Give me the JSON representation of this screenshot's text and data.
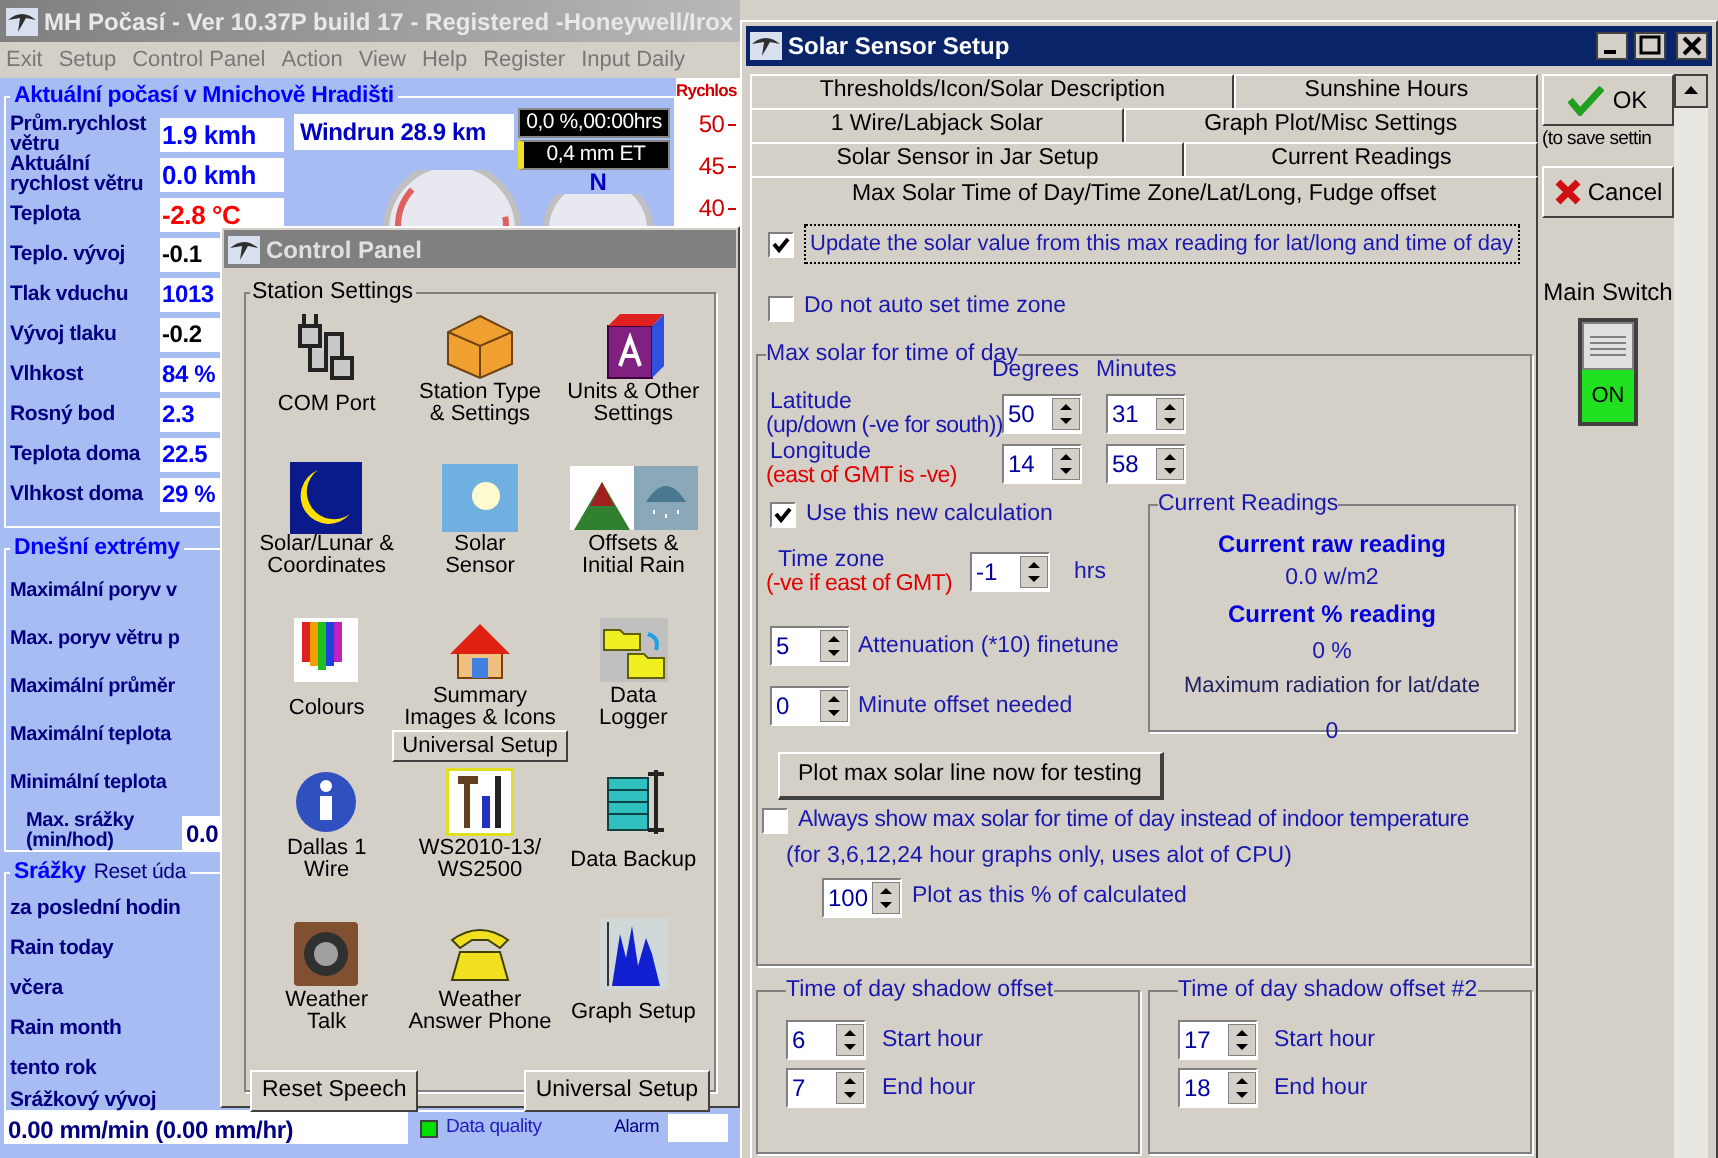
{
  "main_window": {
    "title": "MH Počasí - Ver 10.37P build 17 - Registered  -Honeywell/Irox",
    "menu": [
      "Exit",
      "Setup",
      "Control Panel",
      "Action",
      "View",
      "Help",
      "Register",
      "Input Daily"
    ],
    "current": {
      "title": "Aktuální počasí v Mnichově Hradišti",
      "rows": [
        {
          "label": "Prům.rychlost větru",
          "value": "1.9 kmh",
          "color": "#0000ff"
        },
        {
          "label": "Aktuální rychlost větru",
          "value": "0.0 kmh",
          "color": "#0000ff"
        },
        {
          "label": "Teplota",
          "value": "-2.8 °C",
          "color": "#ff0000"
        },
        {
          "label": "Teplo. vývoj",
          "value": "-0.1",
          "color": "#000000"
        },
        {
          "label": "Tlak vduchu",
          "value": "1013",
          "color": "#0000ff"
        },
        {
          "label": "Vývoj tlaku",
          "value": "-0.2",
          "color": "#000000"
        },
        {
          "label": "Vlhkost",
          "value": "84 %",
          "color": "#0000ff"
        },
        {
          "label": "Rosný bod",
          "value": "2.3",
          "color": "#0000ff"
        },
        {
          "label": "Teplota doma",
          "value": "22.5",
          "color": "#0000ff"
        },
        {
          "label": "Vlhkost doma",
          "value": "29 %",
          "color": "#0000ff"
        }
      ],
      "windrun": "Windrun 28.9 km",
      "displays": [
        "0,0 %,00:00hrs",
        "0,4 mm ET"
      ],
      "compass_label": "N",
      "speed_scale": {
        "title": "Rychlos",
        "ticks": [
          "50",
          "45",
          "40"
        ]
      }
    },
    "extremes": {
      "title": "Dnešní extrémy",
      "rows": [
        "Maximální poryv v",
        "Max. poryv větru p",
        "Maximální průměr",
        "Maximální teplota",
        "Minimální teplota"
      ],
      "rain_rate": {
        "label": "Max. srážky (min/hod)",
        "value": "0.0"
      }
    },
    "rain": {
      "title": "Srážky",
      "reset": "Reset úda",
      "rows": [
        "za poslední hodin",
        "Rain today",
        "včera",
        "Rain month",
        "tento rok"
      ],
      "trend_label": "Srážkový vývoj",
      "trend_value": "0.00 mm/min (0.00 mm/hr)"
    },
    "status": {
      "data_quality": "Data quality",
      "alarm": "Alarm"
    }
  },
  "control_panel": {
    "title": "Control Panel",
    "group": "Station Settings",
    "items": [
      {
        "label": "COM Port"
      },
      {
        "label": "Station Type\n& Settings"
      },
      {
        "label": "Units & Other\nSettings"
      },
      {
        "label": "Solar/Lunar &\nCoordinates"
      },
      {
        "label": "Solar\nSensor"
      },
      {
        "label": "Offsets &\nInitial Rain"
      },
      {
        "label": "Colours"
      },
      {
        "label": "Summary\nImages & Icons",
        "button": "Universal Setup"
      },
      {
        "label": "Data\nLogger"
      },
      {
        "label": "Dallas 1\nWire"
      },
      {
        "label": "WS2010-13/\nWS2500"
      },
      {
        "label": "Data Backup"
      },
      {
        "label": "Weather\nTalk"
      },
      {
        "label": "Weather\nAnswer Phone"
      },
      {
        "label": "Graph Setup"
      }
    ],
    "buttons": [
      "Reset Speech",
      "Universal Setup"
    ]
  },
  "solar_dialog": {
    "title": "Solar Sensor Setup",
    "tab_rows": [
      [
        {
          "label": "Thresholds/Icon/Solar Description",
          "selected": false
        },
        {
          "label": "Sunshine Hours",
          "selected": false
        }
      ],
      [
        {
          "label": "1 Wire/Labjack Solar",
          "selected": false
        },
        {
          "label": "Graph Plot/Misc Settings",
          "selected": false
        }
      ],
      [
        {
          "label": "Solar Sensor in Jar Setup",
          "selected": false
        },
        {
          "label": "Current Readings",
          "selected": false
        }
      ],
      [
        {
          "label": "Max Solar Time of Day/Time Zone/Lat/Long, Fudge offset",
          "selected": true
        }
      ]
    ],
    "update_checkbox": {
      "label": "Update the solar value from this max reading for lat/long and time of day",
      "checked": true
    },
    "auto_tz_checkbox": {
      "label": "Do not auto set time zone",
      "checked": false
    },
    "max_solar": {
      "title": "Max solar for time of day",
      "degrees_header": "Degrees",
      "minutes_header": "Minutes",
      "latitude": {
        "label": "Latitude",
        "note": "(up/down (-ve for south))",
        "degrees": "50",
        "minutes": "31"
      },
      "longitude": {
        "label": "Longitude",
        "note": "(east of GMT is -ve)",
        "degrees": "14",
        "minutes": "58"
      },
      "new_calc_checkbox": {
        "label": "Use this new calculation",
        "checked": true
      },
      "time_zone": {
        "label": "Time zone",
        "note": "(-ve if east of GMT)",
        "value": "-1",
        "unit": "hrs"
      },
      "attenuation": {
        "value": "5",
        "label": "Attenuation (*10) finetune"
      },
      "minute_offset": {
        "value": "0",
        "label": "Minute offset needed"
      },
      "readings": {
        "title": "Current Readings",
        "raw_label": "Current raw reading",
        "raw_value": "0.0 w/m2",
        "pct_label": "Current % reading",
        "pct_value": "0 %",
        "max_label": "Maximum radiation for lat/date",
        "max_value": "0"
      },
      "plot_button": "Plot max solar line now for testing",
      "always_checkbox": {
        "label": "Always show max solar for time of day instead of indoor temperature",
        "checked": false
      },
      "always_note": "(for 3,6,12,24 hour graphs only, uses alot of CPU)",
      "plot_pct": {
        "value": "100",
        "label": "Plot as this % of calculated"
      }
    },
    "shadow_groups": [
      {
        "title": "Time of day shadow offset",
        "rows": [
          {
            "value": "6",
            "label": "Start hour"
          },
          {
            "value": "7",
            "label": "End hour"
          }
        ]
      },
      {
        "title": "Time of day shadow offset #2",
        "rows": [
          {
            "value": "17",
            "label": "Start hour"
          },
          {
            "value": "18",
            "label": "End hour"
          }
        ]
      }
    ],
    "ok_button": "OK",
    "ok_note": "(to save settin",
    "cancel_button": "Cancel",
    "main_switch": {
      "label": "Main Switch",
      "on": true,
      "state_text": "ON"
    }
  }
}
